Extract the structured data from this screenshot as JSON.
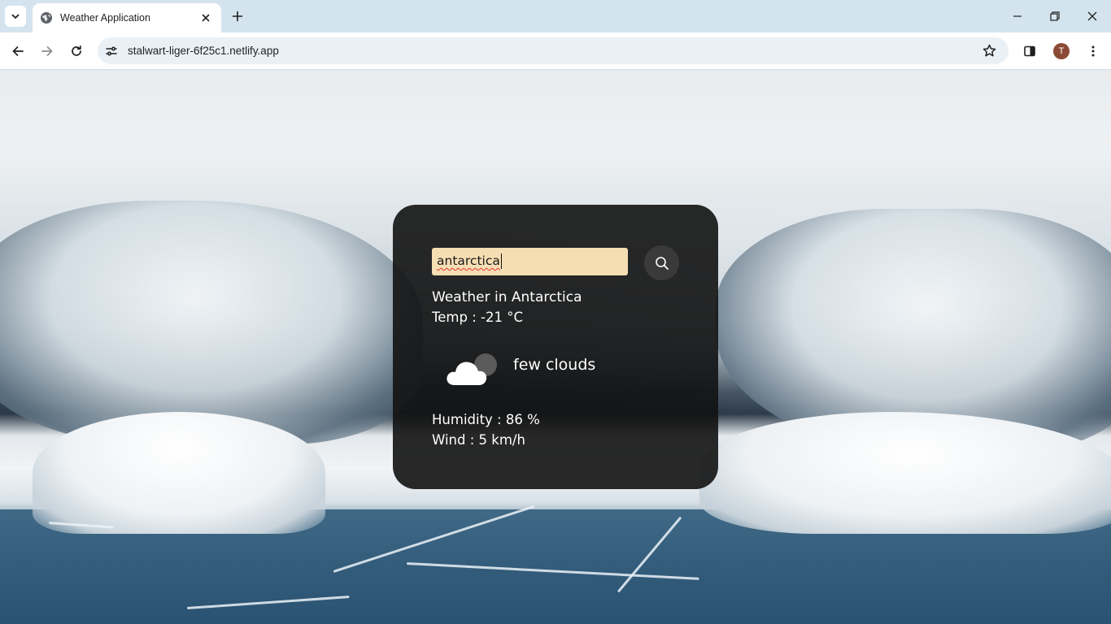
{
  "browser": {
    "tab_title": "Weather Application",
    "url": "stalwart-liger-6f25c1.netlify.app",
    "profile_initial": "T"
  },
  "weather": {
    "search_value": "antarctica",
    "city_line": "Weather in Antarctica",
    "temp_line": "Temp : -21 °C",
    "description": "few clouds",
    "humidity_line": "Humidity : 86 %",
    "wind_line": "Wind : 5 km/h",
    "icon": "few-clouds-icon"
  },
  "colors": {
    "input_bg": "#f6deb3",
    "card_bg": "#121212",
    "search_button_bg": "#3a3a3a"
  }
}
